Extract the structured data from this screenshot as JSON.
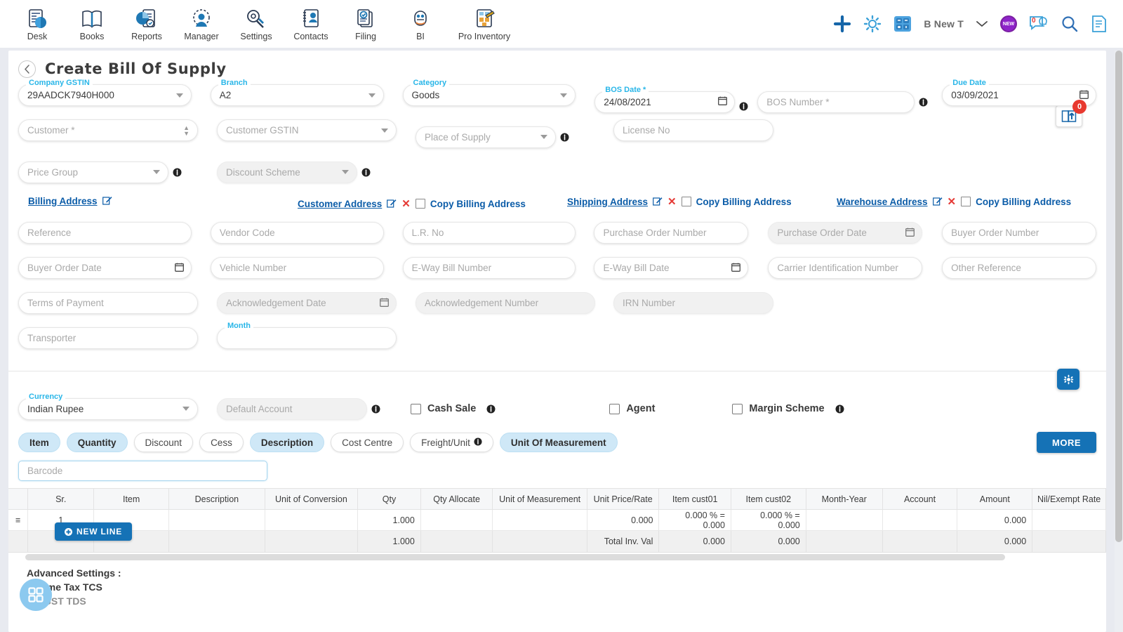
{
  "topnav": {
    "items": [
      {
        "label": "Desk",
        "icon": "desk-icon"
      },
      {
        "label": "Books",
        "icon": "books-icon"
      },
      {
        "label": "Reports",
        "icon": "reports-icon"
      },
      {
        "label": "Manager",
        "icon": "manager-icon"
      },
      {
        "label": "Settings",
        "icon": "settings-icon"
      },
      {
        "label": "Contacts",
        "icon": "contacts-icon"
      },
      {
        "label": "Filing",
        "icon": "filing-icon"
      },
      {
        "label": "BI",
        "icon": "bi-icon"
      },
      {
        "label": "Pro Inventory",
        "icon": "pro-inventory-icon"
      }
    ],
    "user_label": "B New T",
    "new_badge": "NEW",
    "chat_count": "0"
  },
  "header": {
    "title": "Create Bill Of Supply",
    "import_badge": "0"
  },
  "form": {
    "company_gstin": {
      "label": "Company GSTIN",
      "value": "29AADCK7940H000"
    },
    "branch": {
      "label": "Branch",
      "value": "A2"
    },
    "category": {
      "label": "Category",
      "value": "Goods"
    },
    "bos_date": {
      "label": "BOS Date *",
      "value": "24/08/2021"
    },
    "bos_number": {
      "placeholder": "BOS Number *"
    },
    "due_date": {
      "label": "Due Date",
      "value": "03/09/2021"
    },
    "customer": {
      "placeholder": "Customer *"
    },
    "customer_gstin": {
      "placeholder": "Customer GSTIN"
    },
    "place_of_supply": {
      "placeholder": "Place of Supply"
    },
    "license_no": {
      "placeholder": "License No"
    },
    "price_group": {
      "placeholder": "Price Group"
    },
    "discount_scheme": {
      "placeholder": "Discount Scheme"
    },
    "reference": {
      "placeholder": "Reference"
    },
    "vendor_code": {
      "placeholder": "Vendor Code"
    },
    "lr_no": {
      "placeholder": "L.R. No"
    },
    "purchase_order_number": {
      "placeholder": "Purchase Order Number"
    },
    "purchase_order_date": {
      "placeholder": "Purchase Order Date"
    },
    "buyer_order_number": {
      "placeholder": "Buyer Order Number"
    },
    "buyer_order_date": {
      "placeholder": "Buyer Order Date"
    },
    "vehicle_number": {
      "placeholder": "Vehicle Number"
    },
    "eway_bill_number": {
      "placeholder": "E-Way Bill Number"
    },
    "eway_bill_date": {
      "placeholder": "E-Way Bill Date"
    },
    "carrier_id_number": {
      "placeholder": "Carrier Identification Number"
    },
    "other_reference": {
      "placeholder": "Other Reference"
    },
    "terms_of_payment": {
      "placeholder": "Terms of Payment"
    },
    "acknowledgement_date": {
      "placeholder": "Acknowledgement Date"
    },
    "acknowledgement_number": {
      "placeholder": "Acknowledgement Number"
    },
    "irn_number": {
      "placeholder": "IRN Number"
    },
    "transporter": {
      "placeholder": "Transporter"
    },
    "month": {
      "label": "Month",
      "value": ""
    },
    "currency": {
      "label": "Currency",
      "value": "Indian Rupee"
    },
    "default_account": {
      "placeholder": "Default Account"
    }
  },
  "addresses": [
    {
      "label": "Billing Address",
      "has_delete": false,
      "has_copy": false,
      "copy_label": ""
    },
    {
      "label": "Customer Address",
      "has_delete": true,
      "has_copy": true,
      "copy_label": "Copy Billing Address"
    },
    {
      "label": "Shipping Address",
      "has_delete": true,
      "has_copy": true,
      "copy_label": "Copy Billing Address"
    },
    {
      "label": "Warehouse Address",
      "has_delete": true,
      "has_copy": true,
      "copy_label": "Copy Billing Address"
    }
  ],
  "options": {
    "cash_sale": "Cash Sale",
    "agent": "Agent",
    "margin_scheme": "Margin Scheme"
  },
  "chips": [
    {
      "label": "Item",
      "active": true,
      "info": false
    },
    {
      "label": "Quantity",
      "active": true,
      "info": false
    },
    {
      "label": "Discount",
      "active": false,
      "info": false
    },
    {
      "label": "Cess",
      "active": false,
      "info": false
    },
    {
      "label": "Description",
      "active": true,
      "info": false
    },
    {
      "label": "Cost Centre",
      "active": false,
      "info": false
    },
    {
      "label": "Freight/Unit",
      "active": false,
      "info": true
    },
    {
      "label": "Unit Of Measurement",
      "active": true,
      "info": false
    }
  ],
  "more_button": "MORE",
  "barcode": {
    "placeholder": "Barcode"
  },
  "table": {
    "columns": [
      "",
      "Sr.",
      "Item",
      "Description",
      "Unit of Conversion",
      "Qty",
      "Qty Allocate",
      "Unit of Measurement",
      "Unit Price/Rate",
      "Item cust01",
      "Item cust02",
      "Month-Year",
      "Account",
      "Amount",
      "Nil/Exempt Rate"
    ],
    "rows": [
      [
        "≡",
        "1",
        "",
        "",
        "",
        "1.000",
        "",
        "",
        "0.000",
        "0.000 % = 0.000",
        "0.000 % = 0.000",
        "",
        "",
        "0.000",
        ""
      ]
    ],
    "footer": [
      "",
      "",
      "",
      "",
      "",
      "1.000",
      "",
      "",
      "Total Inv. Val",
      "0.000",
      "0.000",
      "",
      "",
      "0.000",
      ""
    ],
    "new_line_button": "NEW LINE"
  },
  "advanced": {
    "title": "Advanced Settings :",
    "income_tax_tcs": "Income Tax TCS",
    "gst_tds": "GST TDS"
  },
  "colors": {
    "accent_blue": "#1572b6",
    "label_blue": "#29b6e8",
    "link_blue": "#0b5ca8",
    "chip_active": "#cfe8f7",
    "danger_red": "#e8392f"
  }
}
